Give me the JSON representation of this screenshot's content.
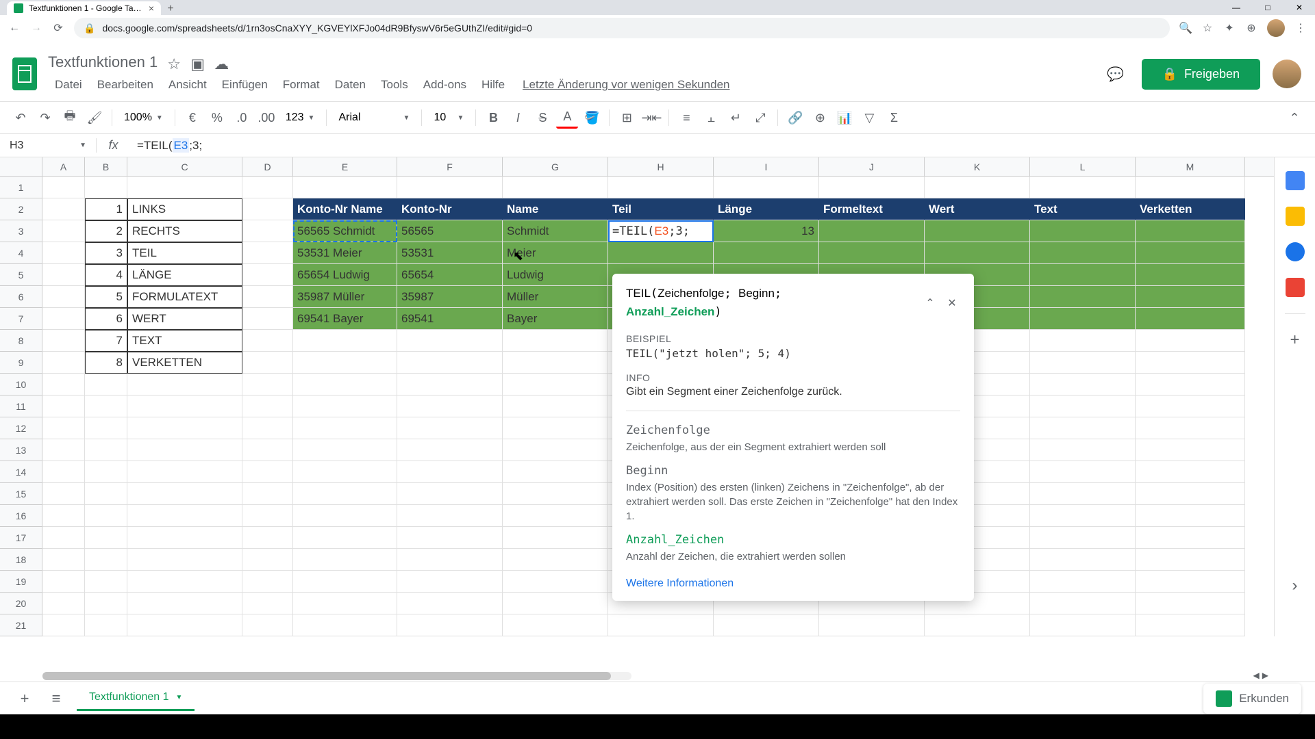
{
  "browser": {
    "tab_title": "Textfunktionen 1 - Google Tabel...",
    "url": "docs.google.com/spreadsheets/d/1rn3osCnaXYY_KGVEYlXFJo04dR9BfyswV6r5eGUthZI/edit#gid=0"
  },
  "doc": {
    "title": "Textfunktionen 1",
    "last_edit": "Letzte Änderung vor wenigen Sekunden",
    "share_label": "Freigeben"
  },
  "menu": {
    "datei": "Datei",
    "bearbeiten": "Bearbeiten",
    "ansicht": "Ansicht",
    "einfuegen": "Einfügen",
    "format": "Format",
    "daten": "Daten",
    "tools": "Tools",
    "addons": "Add-ons",
    "hilfe": "Hilfe"
  },
  "toolbar": {
    "zoom": "100%",
    "currency": "€",
    "percent": "%",
    "dec_less": ".0",
    "dec_more": ".00",
    "num_fmt": "123",
    "font": "Arial",
    "size": "10"
  },
  "formula_bar": {
    "cell": "H3",
    "formula_prefix": "=TEIL(",
    "formula_ref": "E3",
    "formula_suffix": ";3;"
  },
  "columns": [
    "A",
    "B",
    "C",
    "D",
    "E",
    "F",
    "G",
    "H",
    "I",
    "J",
    "K",
    "L",
    "M"
  ],
  "rows_count": 21,
  "left_table": {
    "items": [
      {
        "n": "1",
        "t": "LINKS"
      },
      {
        "n": "2",
        "t": "RECHTS"
      },
      {
        "n": "3",
        "t": "TEIL"
      },
      {
        "n": "4",
        "t": "LÄNGE"
      },
      {
        "n": "5",
        "t": "FORMULATEXT"
      },
      {
        "n": "6",
        "t": "WERT"
      },
      {
        "n": "7",
        "t": "TEXT"
      },
      {
        "n": "8",
        "t": "VERKETTEN"
      }
    ]
  },
  "headers": {
    "e": "Konto-Nr Name",
    "f": "Konto-Nr",
    "g": "Name",
    "h": "Teil",
    "i": "Länge",
    "j": "Formeltext",
    "k": "Wert",
    "l": "Text",
    "m": "Verketten"
  },
  "data_rows": [
    {
      "e": "56565 Schmidt",
      "f": "56565",
      "g": "Schmidt",
      "h": "=TEIL(E3;3;",
      "i": "13"
    },
    {
      "e": "53531 Meier",
      "f": "53531",
      "g": "Meier"
    },
    {
      "e": "65654 Ludwig",
      "f": "65654",
      "g": "Ludwig"
    },
    {
      "e": "35987 Müller",
      "f": "35987",
      "g": "Müller"
    },
    {
      "e": "69541 Bayer",
      "f": "69541",
      "g": "Bayer"
    }
  ],
  "help": {
    "sig_fn": "TEIL",
    "sig_p1": "Zeichenfolge",
    "sig_p2": "Beginn",
    "sig_p3": "Anzahl_Zeichen",
    "beispiel_label": "BEISPIEL",
    "beispiel": "TEIL(\"jetzt holen\"; 5; 4)",
    "info_label": "INFO",
    "info": "Gibt ein Segment einer Zeichenfolge zurück.",
    "p1_name": "Zeichenfolge",
    "p1_desc": "Zeichenfolge, aus der ein Segment extrahiert werden soll",
    "p2_name": "Beginn",
    "p2_desc": "Index (Position) des ersten (linken) Zeichens in \"Zeichenfolge\", ab der extrahiert werden soll. Das erste Zeichen in \"Zeichenfolge\" hat den Index 1.",
    "p3_name": "Anzahl_Zeichen",
    "p3_desc": "Anzahl der Zeichen, die extrahiert werden sollen",
    "more": "Weitere Informationen"
  },
  "bottom": {
    "sheet_name": "Textfunktionen 1",
    "explore": "Erkunden"
  }
}
